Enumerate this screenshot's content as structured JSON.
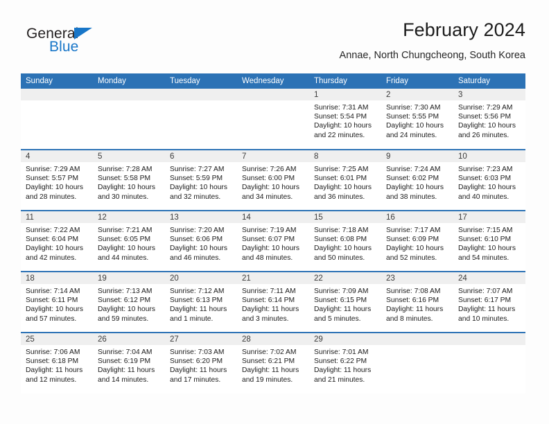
{
  "brand": {
    "name_part1": "General",
    "name_part2": "Blue",
    "triangle_icon": "triangle-icon",
    "colors": {
      "dark": "#231f20",
      "blue": "#1876c8"
    }
  },
  "header": {
    "title": "February 2024",
    "subtitle": "Annae, North Chungcheong, South Korea"
  },
  "theme": {
    "header_blue": "#2c72b5",
    "band_gray": "#efefef",
    "page_bg": "#fdfdfd"
  },
  "calendar": {
    "month": "February",
    "year": "2024",
    "weekday_headers": [
      "Sunday",
      "Monday",
      "Tuesday",
      "Wednesday",
      "Thursday",
      "Friday",
      "Saturday"
    ],
    "labels": {
      "sunrise": "Sunrise:",
      "sunset": "Sunset:",
      "daylight": "Daylight:"
    },
    "weeks": [
      [
        {
          "day": ""
        },
        {
          "day": ""
        },
        {
          "day": ""
        },
        {
          "day": ""
        },
        {
          "day": "1",
          "sunrise": "Sunrise: 7:31 AM",
          "sunset": "Sunset: 5:54 PM",
          "daylight_line1": "Daylight: 10 hours",
          "daylight_line2": "and 22 minutes."
        },
        {
          "day": "2",
          "sunrise": "Sunrise: 7:30 AM",
          "sunset": "Sunset: 5:55 PM",
          "daylight_line1": "Daylight: 10 hours",
          "daylight_line2": "and 24 minutes."
        },
        {
          "day": "3",
          "sunrise": "Sunrise: 7:29 AM",
          "sunset": "Sunset: 5:56 PM",
          "daylight_line1": "Daylight: 10 hours",
          "daylight_line2": "and 26 minutes."
        }
      ],
      [
        {
          "day": "4",
          "sunrise": "Sunrise: 7:29 AM",
          "sunset": "Sunset: 5:57 PM",
          "daylight_line1": "Daylight: 10 hours",
          "daylight_line2": "and 28 minutes."
        },
        {
          "day": "5",
          "sunrise": "Sunrise: 7:28 AM",
          "sunset": "Sunset: 5:58 PM",
          "daylight_line1": "Daylight: 10 hours",
          "daylight_line2": "and 30 minutes."
        },
        {
          "day": "6",
          "sunrise": "Sunrise: 7:27 AM",
          "sunset": "Sunset: 5:59 PM",
          "daylight_line1": "Daylight: 10 hours",
          "daylight_line2": "and 32 minutes."
        },
        {
          "day": "7",
          "sunrise": "Sunrise: 7:26 AM",
          "sunset": "Sunset: 6:00 PM",
          "daylight_line1": "Daylight: 10 hours",
          "daylight_line2": "and 34 minutes."
        },
        {
          "day": "8",
          "sunrise": "Sunrise: 7:25 AM",
          "sunset": "Sunset: 6:01 PM",
          "daylight_line1": "Daylight: 10 hours",
          "daylight_line2": "and 36 minutes."
        },
        {
          "day": "9",
          "sunrise": "Sunrise: 7:24 AM",
          "sunset": "Sunset: 6:02 PM",
          "daylight_line1": "Daylight: 10 hours",
          "daylight_line2": "and 38 minutes."
        },
        {
          "day": "10",
          "sunrise": "Sunrise: 7:23 AM",
          "sunset": "Sunset: 6:03 PM",
          "daylight_line1": "Daylight: 10 hours",
          "daylight_line2": "and 40 minutes."
        }
      ],
      [
        {
          "day": "11",
          "sunrise": "Sunrise: 7:22 AM",
          "sunset": "Sunset: 6:04 PM",
          "daylight_line1": "Daylight: 10 hours",
          "daylight_line2": "and 42 minutes."
        },
        {
          "day": "12",
          "sunrise": "Sunrise: 7:21 AM",
          "sunset": "Sunset: 6:05 PM",
          "daylight_line1": "Daylight: 10 hours",
          "daylight_line2": "and 44 minutes."
        },
        {
          "day": "13",
          "sunrise": "Sunrise: 7:20 AM",
          "sunset": "Sunset: 6:06 PM",
          "daylight_line1": "Daylight: 10 hours",
          "daylight_line2": "and 46 minutes."
        },
        {
          "day": "14",
          "sunrise": "Sunrise: 7:19 AM",
          "sunset": "Sunset: 6:07 PM",
          "daylight_line1": "Daylight: 10 hours",
          "daylight_line2": "and 48 minutes."
        },
        {
          "day": "15",
          "sunrise": "Sunrise: 7:18 AM",
          "sunset": "Sunset: 6:08 PM",
          "daylight_line1": "Daylight: 10 hours",
          "daylight_line2": "and 50 minutes."
        },
        {
          "day": "16",
          "sunrise": "Sunrise: 7:17 AM",
          "sunset": "Sunset: 6:09 PM",
          "daylight_line1": "Daylight: 10 hours",
          "daylight_line2": "and 52 minutes."
        },
        {
          "day": "17",
          "sunrise": "Sunrise: 7:15 AM",
          "sunset": "Sunset: 6:10 PM",
          "daylight_line1": "Daylight: 10 hours",
          "daylight_line2": "and 54 minutes."
        }
      ],
      [
        {
          "day": "18",
          "sunrise": "Sunrise: 7:14 AM",
          "sunset": "Sunset: 6:11 PM",
          "daylight_line1": "Daylight: 10 hours",
          "daylight_line2": "and 57 minutes."
        },
        {
          "day": "19",
          "sunrise": "Sunrise: 7:13 AM",
          "sunset": "Sunset: 6:12 PM",
          "daylight_line1": "Daylight: 10 hours",
          "daylight_line2": "and 59 minutes."
        },
        {
          "day": "20",
          "sunrise": "Sunrise: 7:12 AM",
          "sunset": "Sunset: 6:13 PM",
          "daylight_line1": "Daylight: 11 hours",
          "daylight_line2": "and 1 minute."
        },
        {
          "day": "21",
          "sunrise": "Sunrise: 7:11 AM",
          "sunset": "Sunset: 6:14 PM",
          "daylight_line1": "Daylight: 11 hours",
          "daylight_line2": "and 3 minutes."
        },
        {
          "day": "22",
          "sunrise": "Sunrise: 7:09 AM",
          "sunset": "Sunset: 6:15 PM",
          "daylight_line1": "Daylight: 11 hours",
          "daylight_line2": "and 5 minutes."
        },
        {
          "day": "23",
          "sunrise": "Sunrise: 7:08 AM",
          "sunset": "Sunset: 6:16 PM",
          "daylight_line1": "Daylight: 11 hours",
          "daylight_line2": "and 8 minutes."
        },
        {
          "day": "24",
          "sunrise": "Sunrise: 7:07 AM",
          "sunset": "Sunset: 6:17 PM",
          "daylight_line1": "Daylight: 11 hours",
          "daylight_line2": "and 10 minutes."
        }
      ],
      [
        {
          "day": "25",
          "sunrise": "Sunrise: 7:06 AM",
          "sunset": "Sunset: 6:18 PM",
          "daylight_line1": "Daylight: 11 hours",
          "daylight_line2": "and 12 minutes."
        },
        {
          "day": "26",
          "sunrise": "Sunrise: 7:04 AM",
          "sunset": "Sunset: 6:19 PM",
          "daylight_line1": "Daylight: 11 hours",
          "daylight_line2": "and 14 minutes."
        },
        {
          "day": "27",
          "sunrise": "Sunrise: 7:03 AM",
          "sunset": "Sunset: 6:20 PM",
          "daylight_line1": "Daylight: 11 hours",
          "daylight_line2": "and 17 minutes."
        },
        {
          "day": "28",
          "sunrise": "Sunrise: 7:02 AM",
          "sunset": "Sunset: 6:21 PM",
          "daylight_line1": "Daylight: 11 hours",
          "daylight_line2": "and 19 minutes."
        },
        {
          "day": "29",
          "sunrise": "Sunrise: 7:01 AM",
          "sunset": "Sunset: 6:22 PM",
          "daylight_line1": "Daylight: 11 hours",
          "daylight_line2": "and 21 minutes."
        },
        {
          "day": ""
        },
        {
          "day": ""
        }
      ]
    ]
  }
}
